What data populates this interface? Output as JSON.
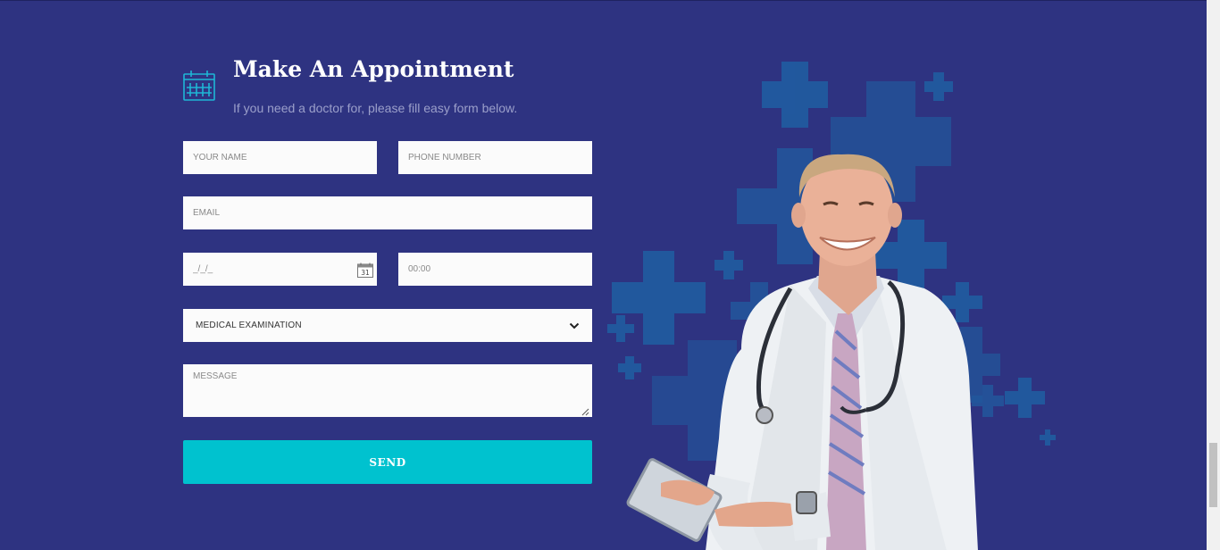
{
  "appointment": {
    "title": "Make An Appointment",
    "subtitle": "If you need a doctor for, please fill easy form below.",
    "icon": "calendar-icon"
  },
  "form": {
    "name_placeholder": "YOUR NAME",
    "phone_placeholder": "PHONE NUMBER",
    "email_placeholder": "EMAIL",
    "date_placeholder": "_/_/_",
    "date_icon_day": "31",
    "time_placeholder": "00:00",
    "service_selected": "MEDICAL EXAMINATION",
    "message_placeholder": "MESSAGE",
    "send_label": "SEND"
  },
  "colors": {
    "background": "#2e3381",
    "accent": "#00c2cf",
    "crosses": "#1f5fa3",
    "field": "#fbfbfb"
  },
  "illustration": {
    "subject": "doctor-with-stethoscope-and-tablet"
  }
}
